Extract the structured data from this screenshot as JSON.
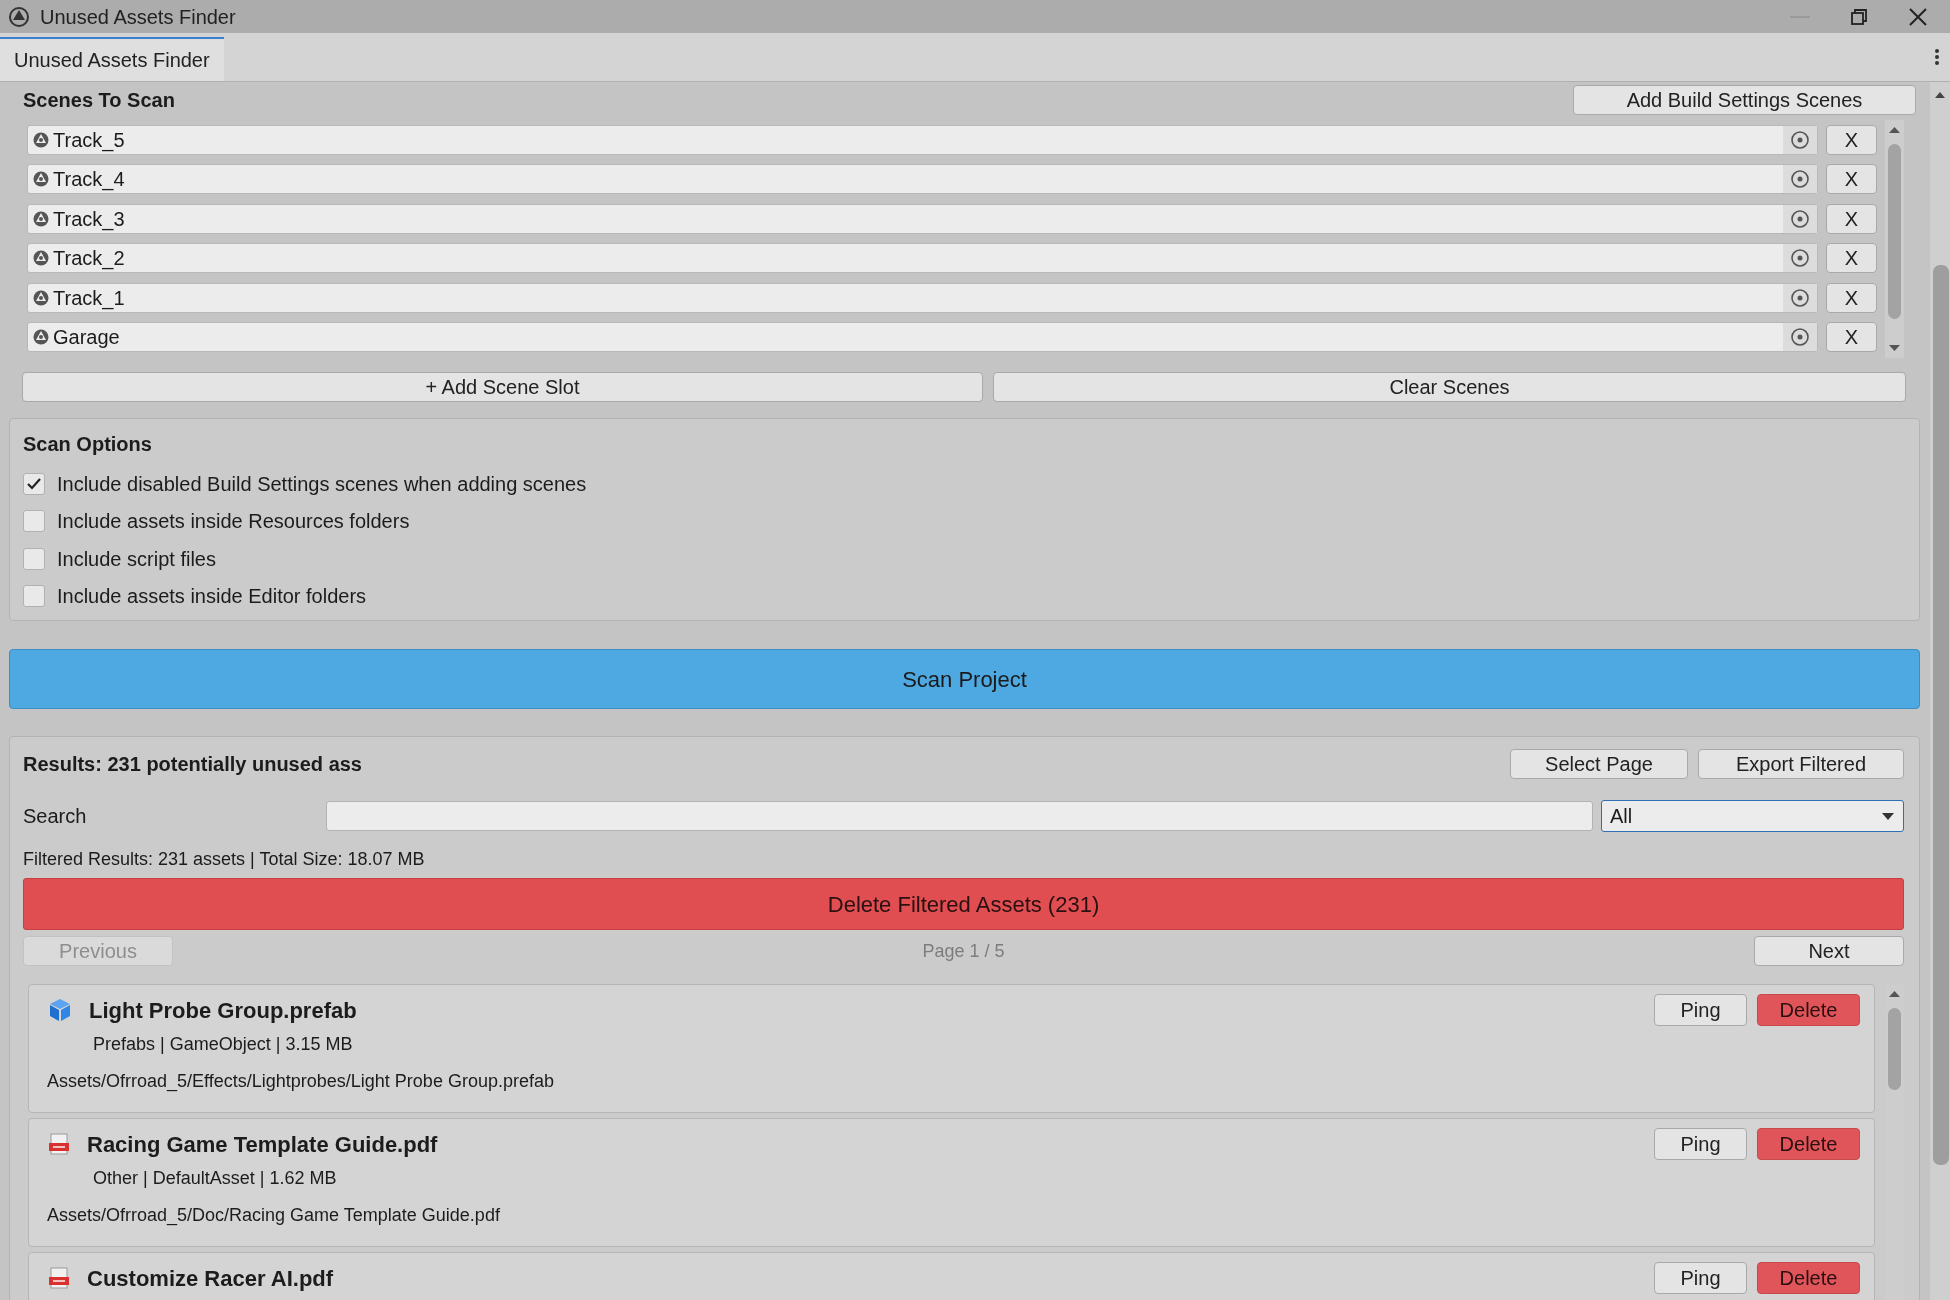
{
  "window": {
    "title": "Unused Assets Finder"
  },
  "tabs": [
    {
      "label": "Unused Assets Finder",
      "selected": true
    }
  ],
  "scenes_section": {
    "title": "Scenes To Scan",
    "add_button": "Add Build Settings Scenes"
  },
  "scenes": [
    {
      "name": "Track_5",
      "remove": "X"
    },
    {
      "name": "Track_4",
      "remove": "X"
    },
    {
      "name": "Track_3",
      "remove": "X"
    },
    {
      "name": "Track_2",
      "remove": "X"
    },
    {
      "name": "Track_1",
      "remove": "X"
    },
    {
      "name": "Garage",
      "remove": "X"
    }
  ],
  "scene_buttons": [
    "+ Add Scene Slot",
    "Clear Scenes"
  ],
  "scan_options": {
    "title": "Scan Options",
    "options": [
      {
        "label": "Include disabled Build Settings scenes when adding scenes",
        "checked": true
      },
      {
        "label": "Include assets inside Resources folders",
        "checked": false
      },
      {
        "label": "Include script files",
        "checked": false
      },
      {
        "label": "Include assets inside Editor folders",
        "checked": false
      }
    ]
  },
  "scan_button": "Scan Project",
  "results": {
    "title": "Results: 231 potentially unused ass",
    "buttons": [
      "Select Page",
      "Export Filtered"
    ],
    "search_label": "Search",
    "filter": "All",
    "summary": "Filtered Results: 231 assets | Total Size: 18.07 MB",
    "delete_all": "Delete Filtered Assets (231)",
    "previous": {
      "label": "Previous",
      "disabled": true
    },
    "page": "Page 1 / 5",
    "next": {
      "label": "Next",
      "disabled": false
    },
    "items": [
      {
        "kind": "prefab",
        "ping": "Ping",
        "delete": "Delete",
        "name": "Light Probe Group.prefab",
        "details": "Prefabs | GameObject | 3.15 MB",
        "path": "Assets/Ofrroad_5/Effects/Lightprobes/Light Probe Group.prefab"
      },
      {
        "kind": "pdf",
        "ping": "Ping",
        "delete": "Delete",
        "name": "Racing Game Template Guide.pdf",
        "details": "Other | DefaultAsset | 1.62 MB",
        "path": "Assets/Ofrroad_5/Doc/Racing Game Template Guide.pdf"
      },
      {
        "kind": "pdf",
        "ping": "Ping",
        "delete": "Delete",
        "name": "Customize Racer AI.pdf"
      }
    ]
  }
}
